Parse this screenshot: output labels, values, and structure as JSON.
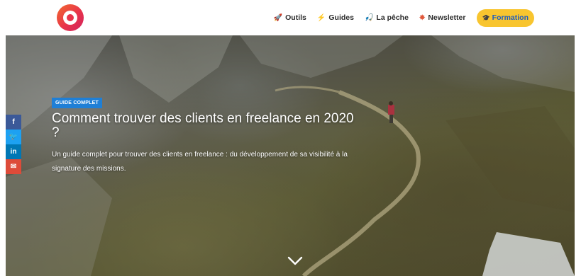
{
  "header": {
    "nav": [
      {
        "icon": "rocket-icon",
        "glyph": "🚀",
        "label": "Outils"
      },
      {
        "icon": "lightning-icon",
        "glyph": "⚡",
        "label": "Guides"
      },
      {
        "icon": "fish-icon",
        "glyph": "🎣",
        "label": "La pêche"
      },
      {
        "icon": "newspaper-icon",
        "glyph": "✸",
        "label": "Newsletter"
      }
    ],
    "cta": {
      "icon": "graduation-cap-icon",
      "glyph": "🎓",
      "label": "Formation"
    }
  },
  "hero": {
    "badge": "GUIDE COMPLET",
    "title": "Comment trouver des clients en freelance en 2020 ?",
    "subtitle": "Un guide complet pour trouver des clients en freelance : du développement de sa visibilité à la signature des missions."
  },
  "share": {
    "facebook": "f",
    "twitter": "🐦",
    "linkedin": "in",
    "email": "✉"
  },
  "colors": {
    "cta_background": "#f8c52f",
    "badge_background": "#1f7fd6",
    "facebook": "#3b5998",
    "twitter": "#1da1f2",
    "linkedin": "#0077b5",
    "email": "#dd4b39"
  }
}
